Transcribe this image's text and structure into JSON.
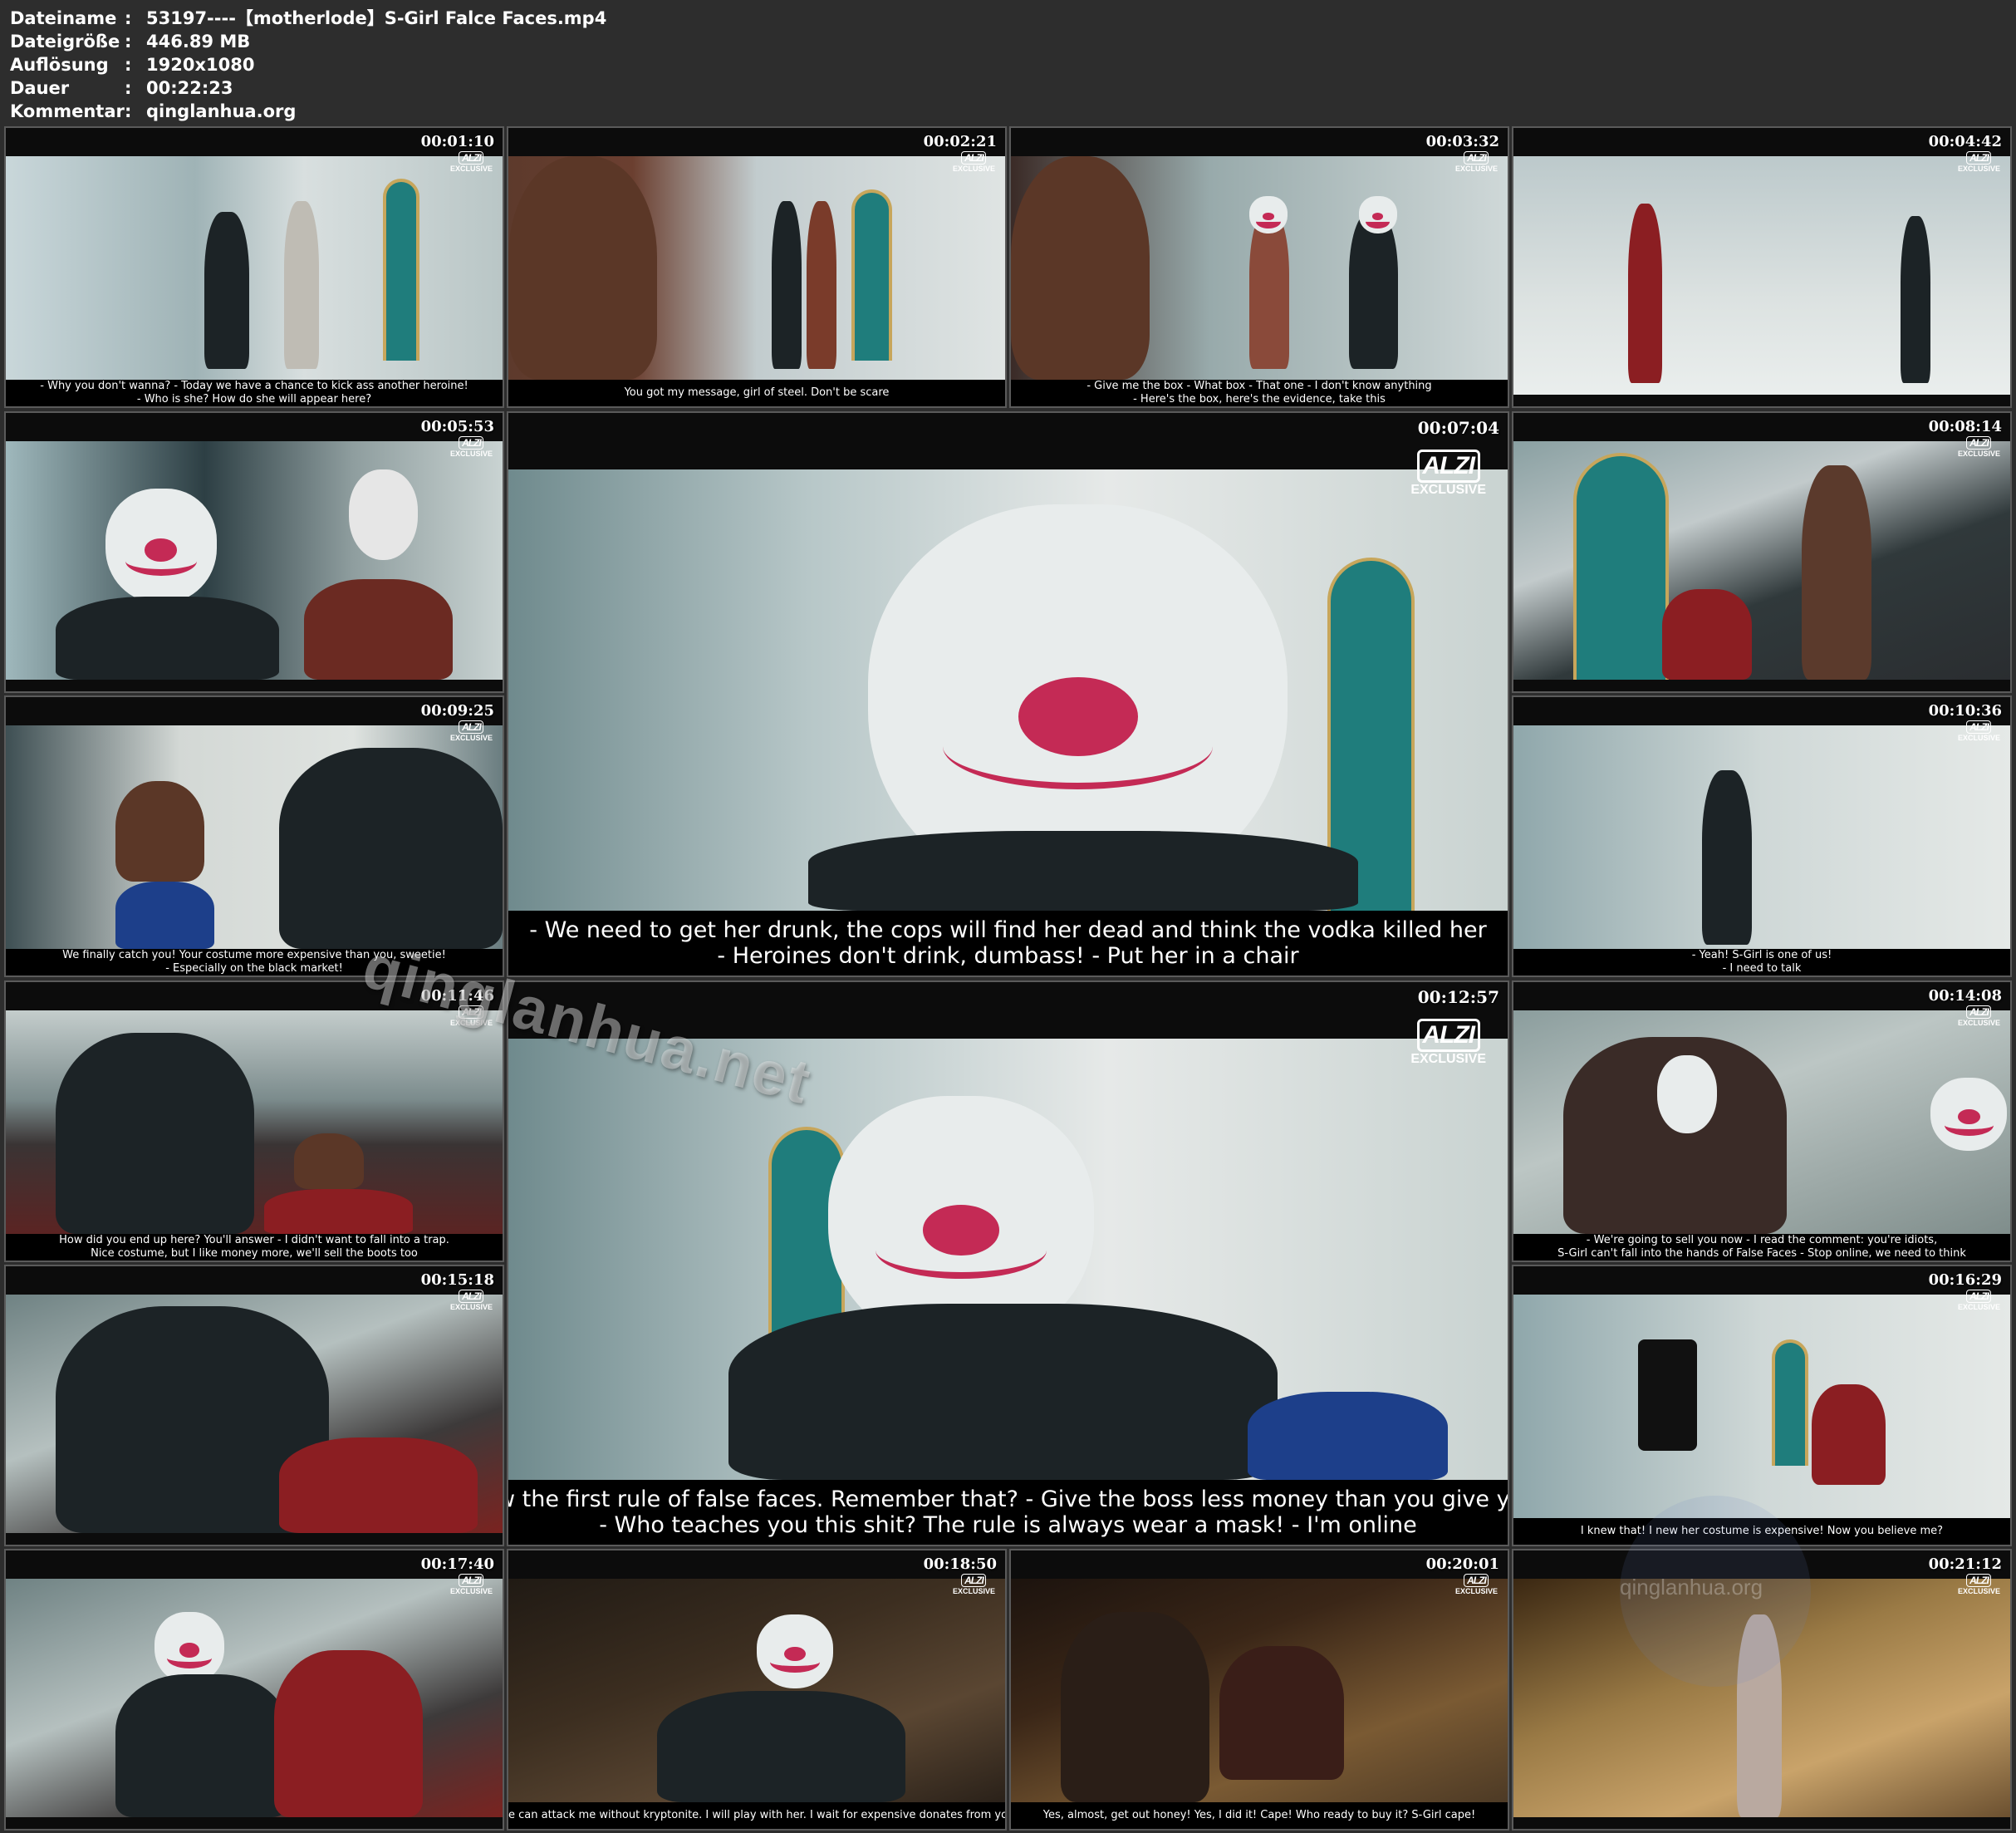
{
  "info": [
    {
      "key": "Dateiname",
      "value": "53197----【motherlode】S-Girl Falce Faces.mp4"
    },
    {
      "key": "Dateigröße",
      "value": "446.89 MB"
    },
    {
      "key": "Auflösung",
      "value": "1920x1080"
    },
    {
      "key": "Dauer",
      "value": "00:22:23"
    },
    {
      "key": "Kommentar",
      "value": "qinglanhua.org"
    }
  ],
  "logo": {
    "mark": "ALZI",
    "sub": "EXCLUSIVE"
  },
  "watermark": "qinglanhua.net",
  "watermark_small": "qinglanhua.org",
  "thumbnails": [
    {
      "time": "00:01:10",
      "subtitle": [
        "- Why you don't wanna? - Today we have a chance to kick ass another heroine!",
        "- Who is she? How do she will appear here?"
      ]
    },
    {
      "time": "00:02:21",
      "subtitle": [
        "You got my message, girl of steel. Don't be scare"
      ]
    },
    {
      "time": "00:03:32",
      "subtitle": [
        "- Give me the box - What box - That one - I don't know anything",
        "- Here's the box, here's the evidence, take this"
      ]
    },
    {
      "time": "00:04:42",
      "subtitle": []
    },
    {
      "time": "00:05:53",
      "subtitle": []
    },
    {
      "time": "00:07:04",
      "subtitle": [
        "- We need to get her drunk, the cops will find her dead and think the vodka killed her",
        "- Heroines don't drink, dumbass! - Put her in a chair"
      ]
    },
    {
      "time": "00:08:14",
      "subtitle": []
    },
    {
      "time": "00:09:25",
      "subtitle": [
        "We finally catch you! Your costume more expensive than you, sweetie!",
        "- Especially on the black market!"
      ]
    },
    {
      "time": "00:10:36",
      "subtitle": [
        "- Yeah! S-Girl is one of us!",
        "- I need to talk"
      ]
    },
    {
      "time": "00:11:46",
      "subtitle": [
        "How did you end up here? You'll answer - I didn't want to fall into a trap.",
        "Nice costume, but I like money more, we'll sell the boots too"
      ]
    },
    {
      "time": "00:12:57",
      "subtitle": [
        "- Follow the first rule of false faces. Remember that? - Give the boss less money than you give yourself",
        "- Who teaches you this shit? The rule is always wear a mask! - I'm online"
      ]
    },
    {
      "time": "00:14:08",
      "subtitle": [
        "- We're going to sell you now - I read the comment: you're idiots,",
        "S-Girl can't fall into the hands of False Faces - Stop online, we need to think"
      ]
    },
    {
      "time": "00:15:18",
      "subtitle": []
    },
    {
      "time": "00:16:29",
      "subtitle": [
        "I knew that! I new her costume is expensive! Now you believe me?"
      ]
    },
    {
      "time": "00:17:40",
      "subtitle": []
    },
    {
      "time": "00:18:50",
      "subtitle": [
        "She can attack me without kryptonite. I will play with her. I wait for expensive donates from you!"
      ]
    },
    {
      "time": "00:20:01",
      "subtitle": [
        "Yes, almost, get out honey! Yes, I did it! Cape! Who ready to buy it? S-Girl cape!"
      ]
    },
    {
      "time": "00:21:12",
      "subtitle": []
    }
  ]
}
